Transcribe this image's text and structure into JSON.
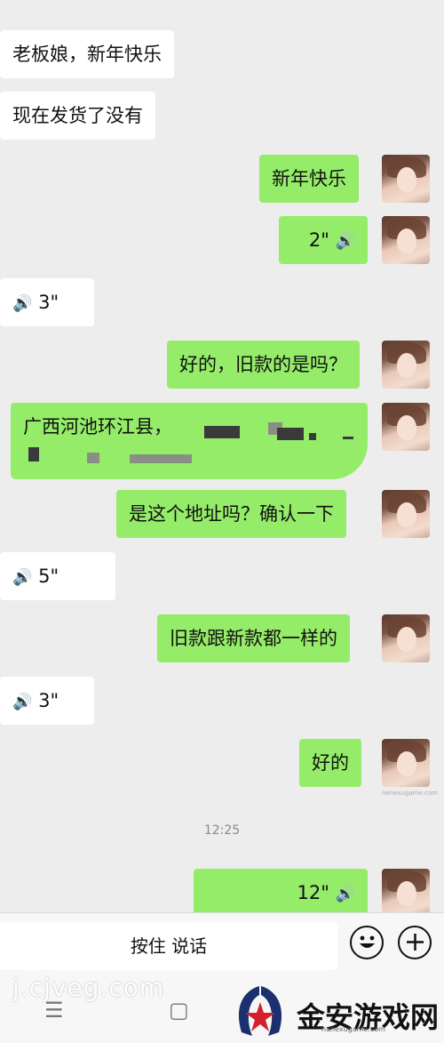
{
  "messages": [
    {
      "side": "in",
      "text": "老板娘，新年快乐"
    },
    {
      "side": "in",
      "text": "现在发货了没有"
    },
    {
      "side": "out",
      "text": "新年快乐"
    },
    {
      "side": "out",
      "voice": "2\""
    },
    {
      "side": "in",
      "voice": "3\""
    },
    {
      "side": "out",
      "text": "好的，旧款的是吗？"
    },
    {
      "side": "out",
      "text": "广西河池环江县，"
    },
    {
      "side": "out",
      "text": "是这个地址吗？确认一下"
    },
    {
      "side": "in",
      "voice": "5\""
    },
    {
      "side": "out",
      "text": "旧款跟新款都一样的"
    },
    {
      "side": "in",
      "voice": "3\""
    },
    {
      "side": "out",
      "text": "好的"
    },
    {
      "side": "out",
      "voice": "12\""
    }
  ],
  "timestamp": "12:25",
  "input_bar": {
    "talk_label": "按住 说话",
    "emoji_icon": "emoji-icon",
    "plus_icon": "plus-icon"
  },
  "navbar": {
    "menu_icon": "menu-icon",
    "home_icon": "home-icon"
  },
  "watermark": {
    "text": "j.cjveg.com",
    "logo_text": "金安游戏网",
    "logo_sub": "nanexugame.com",
    "small": "nenexugame.com"
  },
  "colors": {
    "background": "#ededed",
    "outgoing": "#95ec69",
    "incoming": "#ffffff"
  }
}
